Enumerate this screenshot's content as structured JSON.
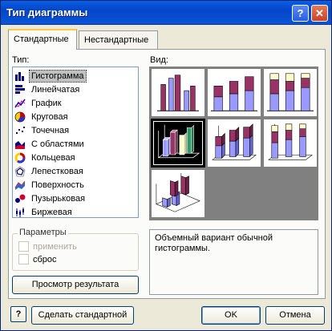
{
  "window": {
    "title": "Тип диаграммы"
  },
  "titlebar": {
    "help_glyph": "?",
    "close_glyph": "✕"
  },
  "tabs": [
    {
      "label": "Стандартные",
      "active": true
    },
    {
      "label": "Нестандартные",
      "active": false
    }
  ],
  "type_section": {
    "label": "Тип:",
    "items": [
      {
        "label": "Гистограмма",
        "icon": "column-chart-icon",
        "selected": true
      },
      {
        "label": "Линейчатая",
        "icon": "bar-chart-icon"
      },
      {
        "label": "График",
        "icon": "line-chart-icon"
      },
      {
        "label": "Круговая",
        "icon": "pie-chart-icon"
      },
      {
        "label": "Точечная",
        "icon": "scatter-chart-icon"
      },
      {
        "label": "С областями",
        "icon": "area-chart-icon"
      },
      {
        "label": "Кольцевая",
        "icon": "doughnut-chart-icon"
      },
      {
        "label": "Лепестковая",
        "icon": "radar-chart-icon"
      },
      {
        "label": "Поверхность",
        "icon": "surface-chart-icon"
      },
      {
        "label": "Пузырьковая",
        "icon": "bubble-chart-icon"
      },
      {
        "label": "Биржевая",
        "icon": "stock-chart-icon"
      }
    ]
  },
  "view_section": {
    "label": "Вид:",
    "subtypes": [
      {
        "name": "clustered-column",
        "selected": false
      },
      {
        "name": "stacked-column",
        "selected": false
      },
      {
        "name": "100-stacked-column",
        "selected": false
      },
      {
        "name": "3d-clustered-column",
        "selected": true
      },
      {
        "name": "3d-stacked-column",
        "selected": false
      },
      {
        "name": "3d-100-stacked-column",
        "selected": false
      },
      {
        "name": "3d-column",
        "selected": false
      }
    ]
  },
  "options": {
    "group_label": "Параметры",
    "apply_label": "применить",
    "apply_enabled": false,
    "reset_label": "сброс"
  },
  "description": "Объемный вариант обычной гистограммы.",
  "buttons": {
    "preview": "Просмотр результата",
    "set_default": "Сделать стандартной",
    "ok": "OK",
    "cancel": "Отмена",
    "help": "?"
  },
  "colors": {
    "series1": "#993366",
    "series2": "#9999ff",
    "series3": "#ffffcc",
    "selected_bg": "#000000"
  }
}
